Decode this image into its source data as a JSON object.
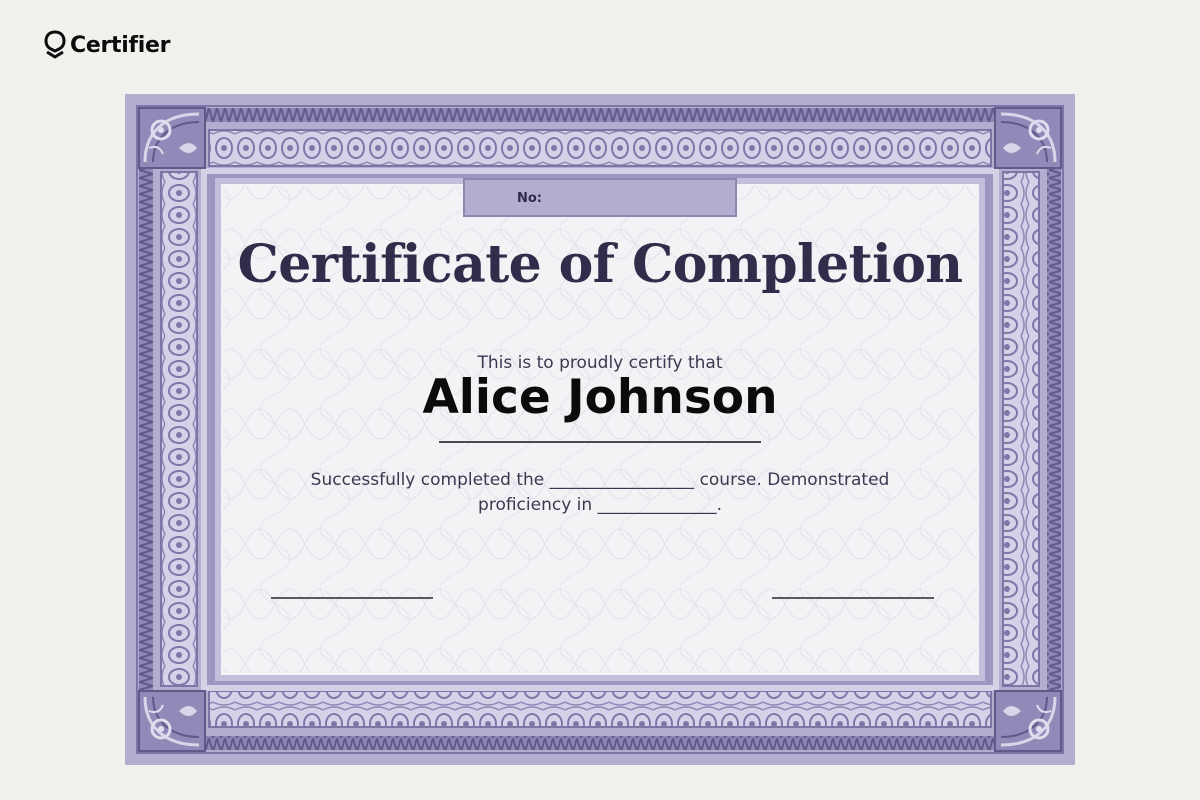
{
  "brand": {
    "name": "Certifier",
    "logo_icon": "certifier-logo-icon"
  },
  "certificate": {
    "number_label": "No:",
    "title": "Certificate of Completion",
    "subtitle": "This is to proudly certify that",
    "recipient_name": "Alice Johnson",
    "body_line_1": "Successfully completed the _________________ course. Demonstrated",
    "body_line_2": "proficiency in ______________."
  },
  "colors": {
    "page_background": "#f2f1ee",
    "frame_lavender": "#b3aed0",
    "frame_dark": "#6f6a99",
    "frame_light": "#dcd8ec",
    "panel_background": "#f3f2f5",
    "title_color": "#302d4b"
  }
}
